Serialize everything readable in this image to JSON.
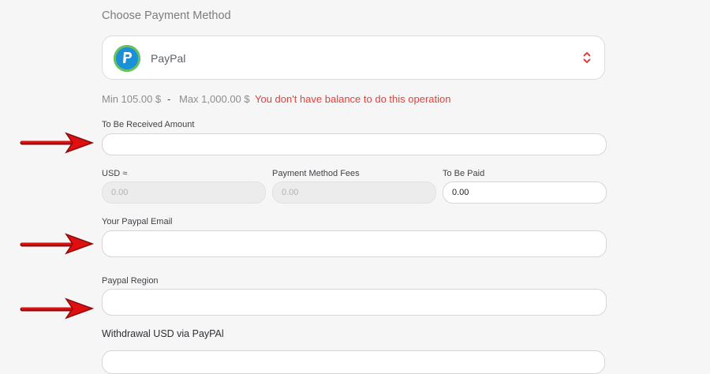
{
  "payment": {
    "section_title": "Choose Payment Method",
    "method_label": "PayPal",
    "limit_min": "Min 105.00 $",
    "limit_separator": "-",
    "limit_max": "Max 1,000.00 $",
    "error": "You don't have balance to do this operation"
  },
  "form": {
    "received_label": "To Be Received Amount",
    "received_value": "",
    "usd_label": "USD ≈",
    "usd_value": "0.00",
    "fees_label": "Payment Method Fees",
    "fees_value": "0.00",
    "paid_label": "To Be Paid",
    "paid_value": "0.00",
    "email_label": "Your Paypal Email",
    "email_value": "",
    "region_label": "Paypal Region",
    "region_value": ""
  },
  "footer": {
    "title": "Withdrawal USD via PayPAl"
  },
  "colors": {
    "error": "#e0413a",
    "arrow": "#e01010",
    "paypal_blue": "#1b8fd8",
    "paypal_ring": "#67c25a"
  },
  "icons": [
    "paypal-logo-icon",
    "chevron-up-down-icon",
    "red-arrow-icon"
  ]
}
